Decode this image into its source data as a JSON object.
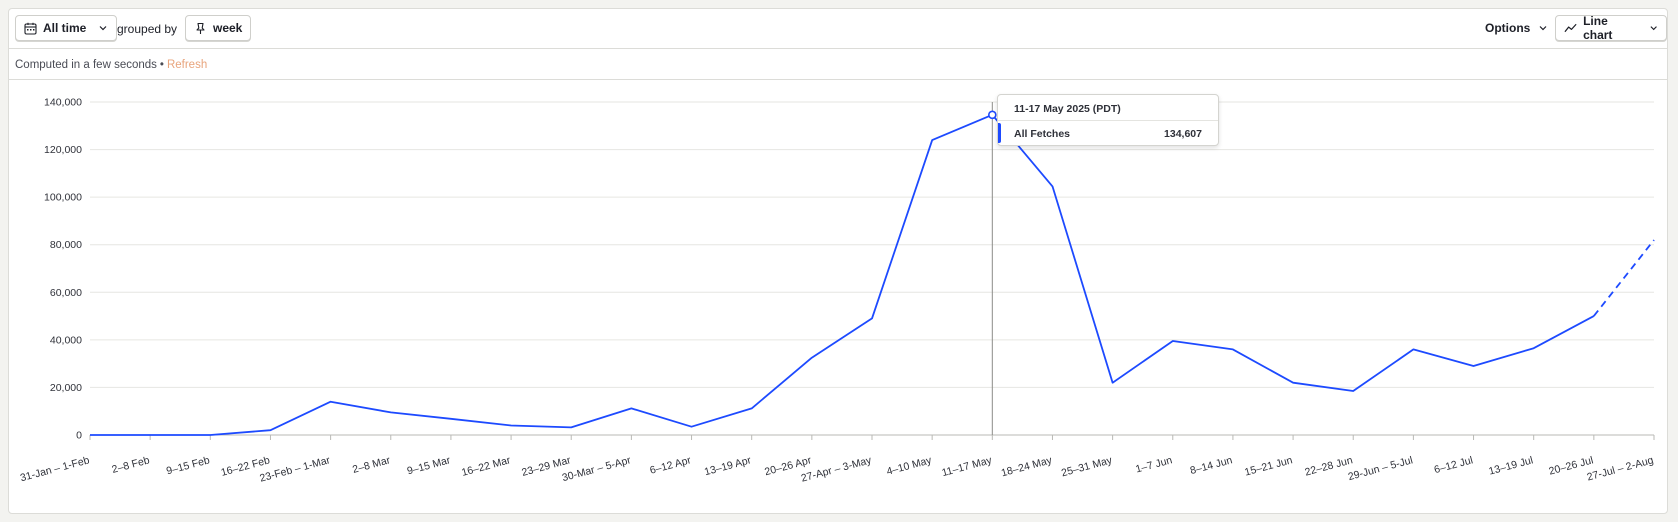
{
  "toolbar": {
    "date_range_label": "All time",
    "grouped_by_text": "grouped by",
    "interval_label": "week",
    "options_label": "Options",
    "chart_type_label": "Line chart"
  },
  "status": {
    "computed_text": "Computed in a few seconds",
    "separator": "•",
    "refresh_label": "Refresh"
  },
  "tooltip": {
    "title": "11-17 May 2025 (PDT)",
    "series_label": "All Fetches",
    "series_value": "134,607"
  },
  "colors": {
    "series": "#1d4aff",
    "refresh": "#e8a47c"
  },
  "chart_data": {
    "type": "line",
    "y_ticks": [
      "0",
      "20,000",
      "40,000",
      "60,000",
      "80,000",
      "100,000",
      "120,000",
      "140,000"
    ],
    "ylim": [
      0,
      140000
    ],
    "grid": true,
    "categories": [
      "31-Jan – 1-Feb",
      "2–8 Feb",
      "9–15 Feb",
      "16–22 Feb",
      "23-Feb – 1-Mar",
      "2–8 Mar",
      "9–15 Mar",
      "16–22 Mar",
      "23–29 Mar",
      "30-Mar – 5-Apr",
      "6–12 Apr",
      "13–19 Apr",
      "20–26 Apr",
      "27-Apr – 3-May",
      "4–10 May",
      "11–17 May",
      "18–24 May",
      "25–31 May",
      "1–7 Jun",
      "8–14 Jun",
      "15–21 Jun",
      "22–28 Jun",
      "29-Jun – 5-Jul",
      "6–12 Jul",
      "13–19 Jul",
      "20–26 Jul",
      "27-Jul – 2-Aug"
    ],
    "series": [
      {
        "values": [
          0,
          0,
          0,
          2000,
          14000,
          9500,
          6800,
          4000,
          3200,
          11200,
          3500,
          11200,
          32500,
          49000,
          124000,
          134607,
          104500,
          22000,
          39500,
          36000,
          22000,
          18500,
          36000,
          29000,
          36500,
          50000,
          82000
        ],
        "dashed_from_index": 25
      }
    ],
    "hover_index": 15
  }
}
